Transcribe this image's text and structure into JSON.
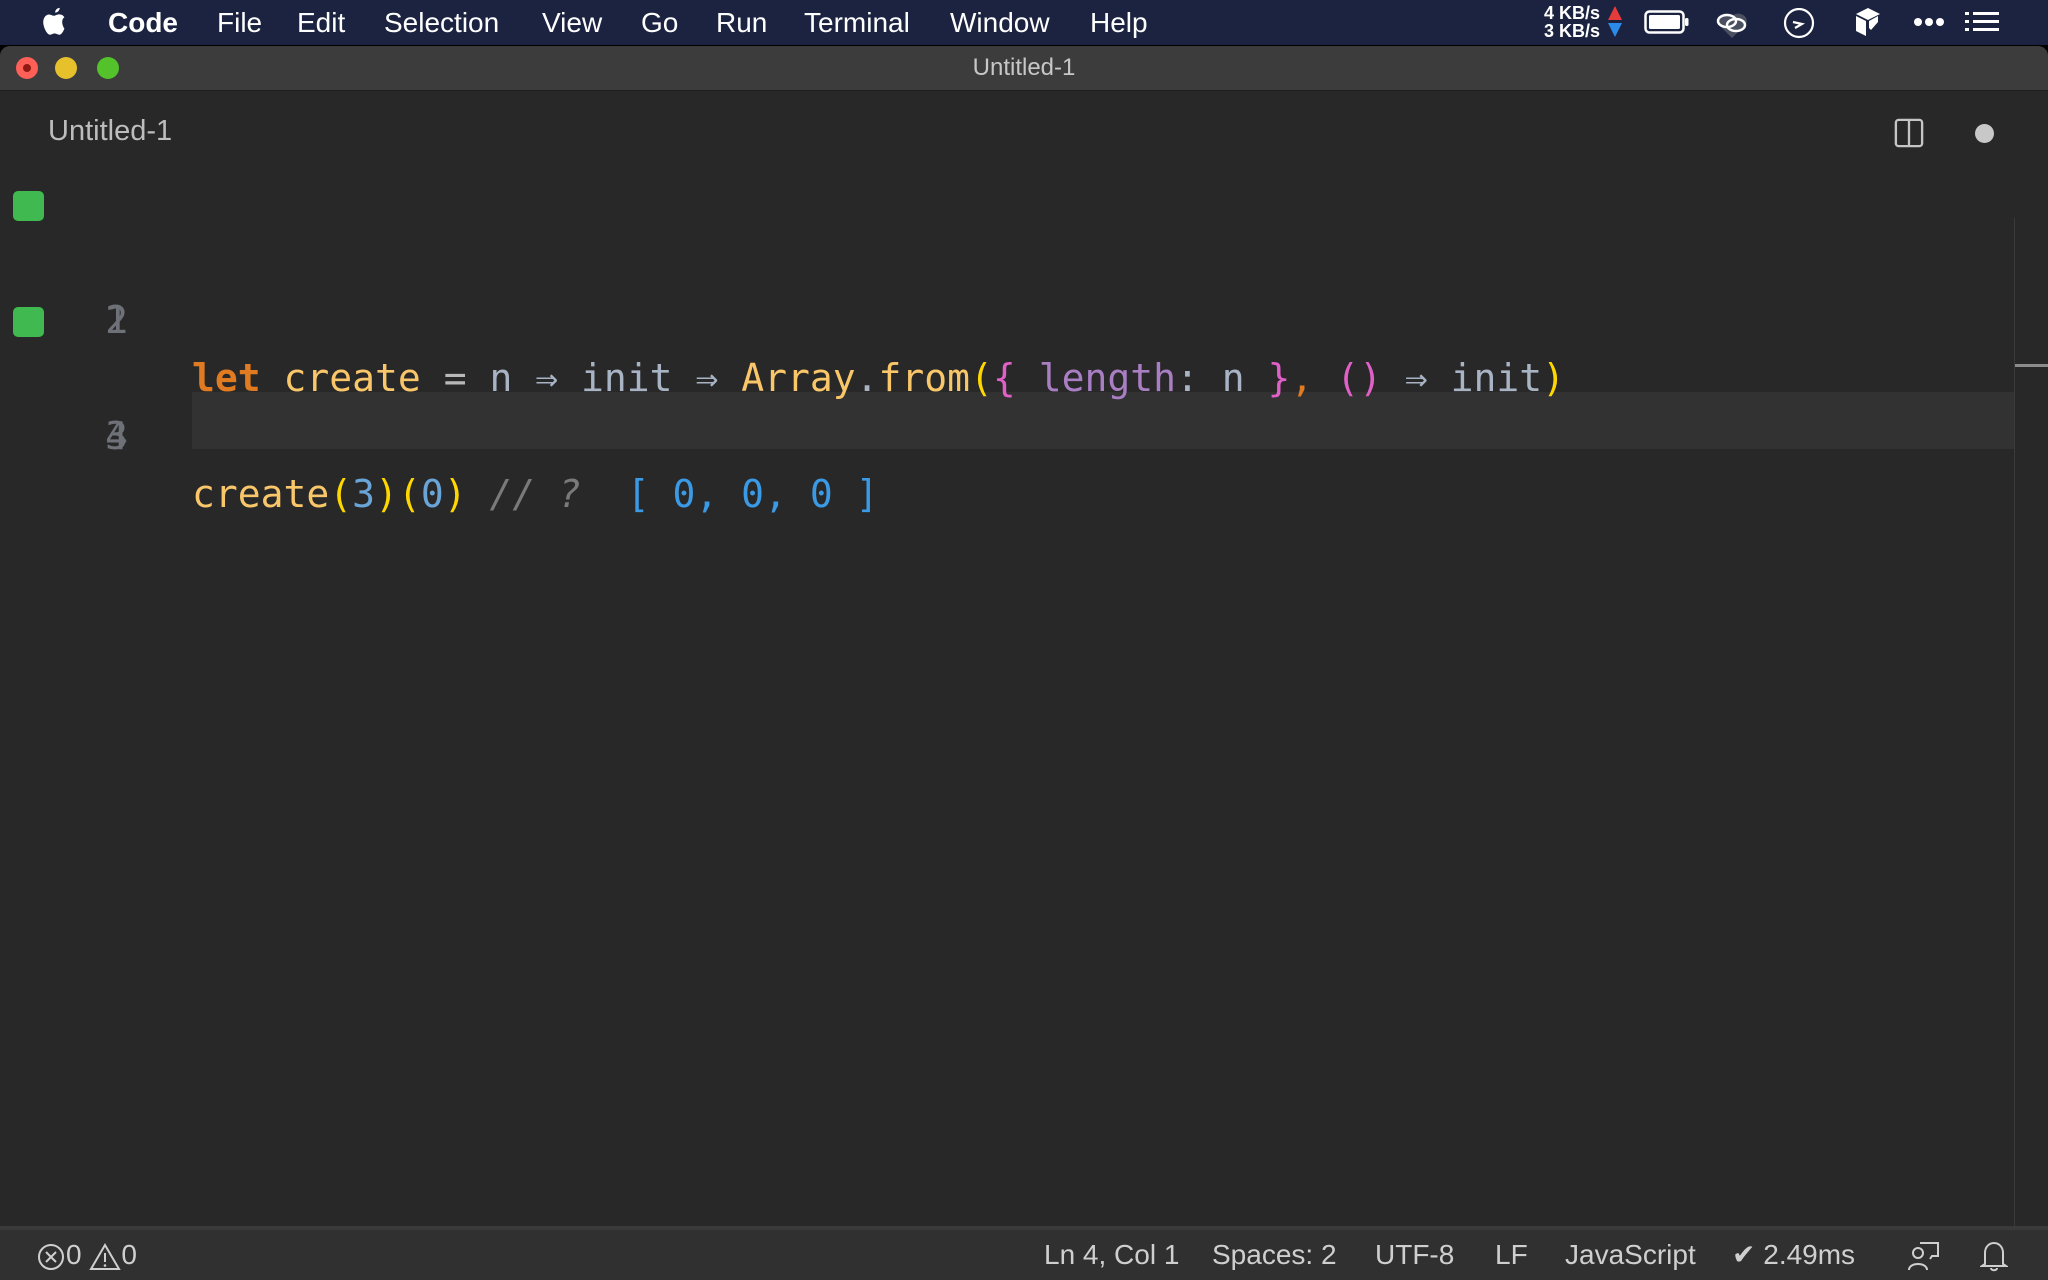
{
  "menubar": {
    "app_name": "Code",
    "items": [
      "File",
      "Edit",
      "Selection",
      "View",
      "Go",
      "Run",
      "Terminal",
      "Window",
      "Help"
    ],
    "net_up": "4 KB/s",
    "net_down": "3 KB/s",
    "icons": [
      "apple-icon",
      "battery-icon",
      "creative-cloud-icon",
      "clock-icon",
      "dropbox-icon",
      "more-icon",
      "list-icon"
    ]
  },
  "window": {
    "title": "Untitled-1"
  },
  "tab": {
    "label": "Untitled-1"
  },
  "editor": {
    "lines": [
      {
        "number": "1",
        "marker": true
      },
      {
        "number": "2",
        "marker": false
      },
      {
        "number": "3",
        "marker": true
      },
      {
        "number": "4",
        "marker": false
      }
    ],
    "tokens_line1": {
      "let": "let",
      "create": "create",
      "eq": "=",
      "n": "n",
      "arrow1": "⇒",
      "init": "init",
      "arrow2": "⇒",
      "Array": "Array",
      "dot": ".",
      "from": "from",
      "paren_open": "(",
      "brace_open": "{",
      "length": "length",
      "colon": ":",
      "n2": "n",
      "brace_close": "}",
      "comma": ",",
      "empty_parens": "()",
      "arrow3": "⇒",
      "init2": "init",
      "paren_close": ")"
    },
    "tokens_line3": {
      "create": "create",
      "p1o": "(",
      "arg1": "3",
      "p1c": ")",
      "p2o": "(",
      "arg2": "0",
      "p2c": ")",
      "comment": "// ?",
      "result": "[ 0, 0, 0 ]"
    },
    "marker_color": "#3fb950"
  },
  "statusbar": {
    "errors": "0",
    "warnings": "0",
    "position": "Ln 4, Col 1",
    "indent": "Spaces: 2",
    "encoding": "UTF-8",
    "eol": "LF",
    "language": "JavaScript",
    "timing": "✔ 2.49ms"
  }
}
